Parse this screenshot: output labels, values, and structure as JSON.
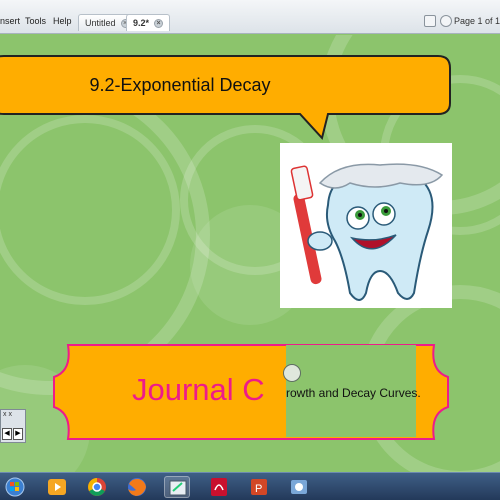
{
  "menubar": {
    "items": [
      "nsert",
      "Tools",
      "Help"
    ]
  },
  "tabs": [
    {
      "label": "Untitled",
      "active": false
    },
    {
      "label": "9.2*",
      "active": true
    }
  ],
  "page_indicator": "Page 1 of 1",
  "slide": {
    "title": "9.2-Exponential Decay",
    "banner_text": "Journal C",
    "overlay_text": "rowth and Decay Curves."
  },
  "mini_toolbar": {
    "close": "x x",
    "prev": "◀",
    "next": "▶"
  },
  "colors": {
    "background": "#8cc46c",
    "bubble": "#ffad00",
    "banner_fill": "#ffad00",
    "banner_border": "#ee1b8a",
    "banner_text": "#ee1b8a"
  },
  "taskbar": {
    "icons": [
      "start-orb-icon",
      "media-player-icon",
      "chrome-icon",
      "firefox-icon",
      "whiteboard-app-icon",
      "pdf-icon",
      "powerpoint-icon",
      "tools-icon"
    ]
  }
}
